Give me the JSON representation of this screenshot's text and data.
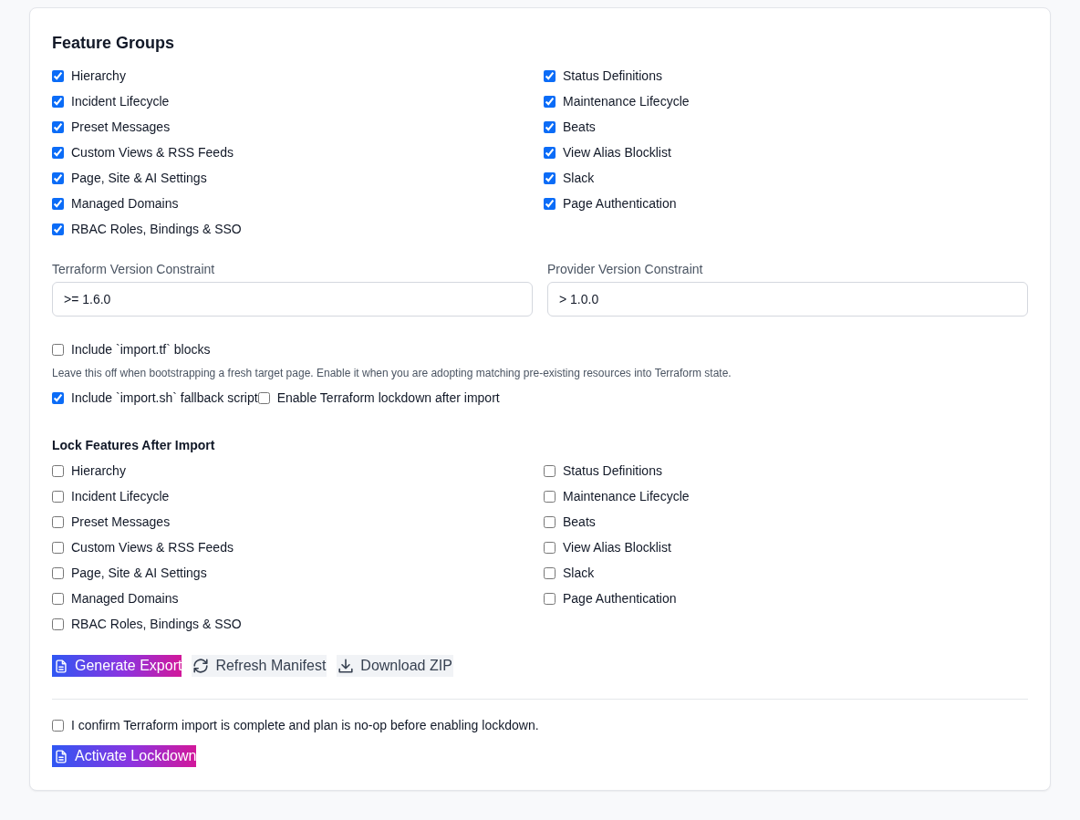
{
  "feature_groups": {
    "title": "Feature Groups",
    "items": [
      {
        "label": "Hierarchy",
        "checked": true
      },
      {
        "label": "Status Definitions",
        "checked": true
      },
      {
        "label": "Incident Lifecycle",
        "checked": true
      },
      {
        "label": "Maintenance Lifecycle",
        "checked": true
      },
      {
        "label": "Preset Messages",
        "checked": true
      },
      {
        "label": "Beats",
        "checked": true
      },
      {
        "label": "Custom Views & RSS Feeds",
        "checked": true
      },
      {
        "label": "View Alias Blocklist",
        "checked": true
      },
      {
        "label": "Page, Site & AI Settings",
        "checked": true
      },
      {
        "label": "Slack",
        "checked": true
      },
      {
        "label": "Managed Domains",
        "checked": true
      },
      {
        "label": "Page Authentication",
        "checked": true
      },
      {
        "label": "RBAC Roles, Bindings & SSO",
        "checked": true
      }
    ]
  },
  "version_constraints": [
    {
      "label": "Terraform Version Constraint",
      "value": ">= 1.6.0"
    },
    {
      "label": "Provider Version Constraint",
      "value": "> 1.0.0"
    }
  ],
  "import_tf": {
    "label": "Include `import.tf` blocks",
    "checked": false,
    "hint": "Leave this off when bootstrapping a fresh target page. Enable it when you are adopting matching pre-existing resources into Terraform state."
  },
  "options": [
    {
      "label": "Include `import.sh` fallback script",
      "checked": true
    },
    {
      "label": "Enable Terraform lockdown after import",
      "checked": false
    }
  ],
  "lock_features": {
    "title": "Lock Features After Import",
    "items": [
      {
        "label": "Hierarchy",
        "checked": false
      },
      {
        "label": "Status Definitions",
        "checked": false
      },
      {
        "label": "Incident Lifecycle",
        "checked": false
      },
      {
        "label": "Maintenance Lifecycle",
        "checked": false
      },
      {
        "label": "Preset Messages",
        "checked": false
      },
      {
        "label": "Beats",
        "checked": false
      },
      {
        "label": "Custom Views & RSS Feeds",
        "checked": false
      },
      {
        "label": "View Alias Blocklist",
        "checked": false
      },
      {
        "label": "Page, Site & AI Settings",
        "checked": false
      },
      {
        "label": "Slack",
        "checked": false
      },
      {
        "label": "Managed Domains",
        "checked": false
      },
      {
        "label": "Page Authentication",
        "checked": false
      },
      {
        "label": "RBAC Roles, Bindings & SSO",
        "checked": false
      }
    ]
  },
  "actions": [
    {
      "label": "Generate Export",
      "kind": "primary"
    },
    {
      "label": "Refresh Manifest",
      "kind": "secondary"
    },
    {
      "label": "Download ZIP",
      "kind": "secondary"
    }
  ],
  "confirm": {
    "label": "I confirm Terraform import is complete and plan is no-op before enabling lockdown.",
    "checked": false
  },
  "lockdown_button": {
    "label": "Activate Lockdown",
    "kind": "primary"
  }
}
